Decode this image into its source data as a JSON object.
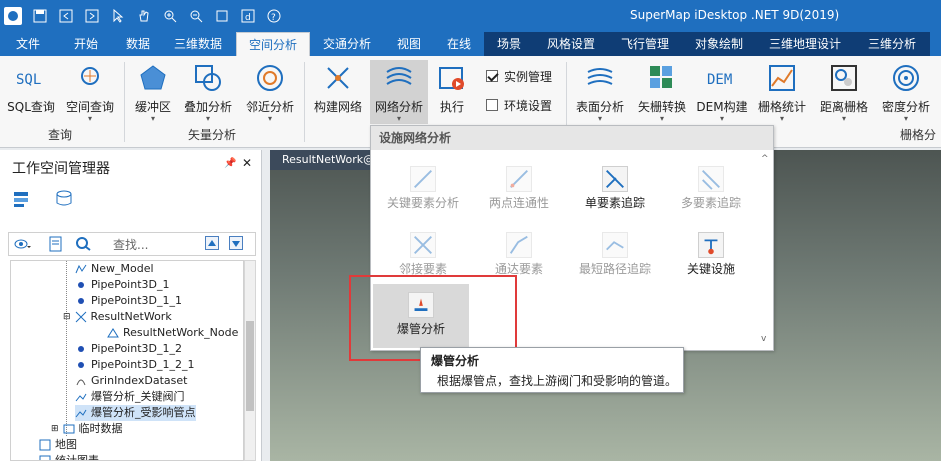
{
  "titlebar": {
    "title": "SuperMap iDesktop .NET 9D(2019)"
  },
  "tabs": [
    "文件",
    "开始",
    "数据",
    "三维数据",
    "空间分析",
    "交通分析",
    "视图",
    "在线",
    "场景",
    "风格设置",
    "飞行管理",
    "对象绘制",
    "三维地理设计",
    "三维分析"
  ],
  "active_tab": "空间分析",
  "ribbon": {
    "buttons": [
      "SQL查询",
      "空间查询",
      "缓冲区",
      "叠加分析",
      "邻近分析",
      "构建网络",
      "网络分析",
      "执行",
      "表面分析",
      "矢栅转换",
      "DEM构建",
      "栅格统计",
      "距离栅格",
      "密度分析"
    ],
    "checkboxes": [
      {
        "label": "实例管理",
        "checked": true
      },
      {
        "label": "环境设置",
        "checked": false
      }
    ],
    "groups": [
      "查询",
      "矢量分析",
      "栅格分"
    ]
  },
  "workspace": {
    "title": "工作空间管理器",
    "search_placeholder": "查找...",
    "tree": [
      "New_Model",
      "PipePoint3D_1",
      "PipePoint3D_1_1",
      "ResultNetWork",
      "ResultNetWork_Node",
      "PipePoint3D_1_2",
      "PipePoint3D_1_2_1",
      "GrinIndexDataset",
      "爆管分析_关键阀门",
      "爆管分析_受影响管点",
      "临时数据",
      "地图",
      "统计图表"
    ]
  },
  "map_tab": "ResultNetWork@",
  "menu": {
    "header": "设施网络分析",
    "items": [
      "关键要素分析",
      "两点连通性",
      "单要素追踪",
      "多要素追踪",
      "邻接要素",
      "通达要素",
      "最短路径追踪",
      "关键设施",
      "爆管分析"
    ]
  },
  "tooltip": {
    "title": "爆管分析",
    "desc": "根据爆管点，查找上游阀门和受影响的管道。"
  },
  "colors": {
    "brand": "#1f6fbf",
    "highlight": "#e03a3a"
  }
}
